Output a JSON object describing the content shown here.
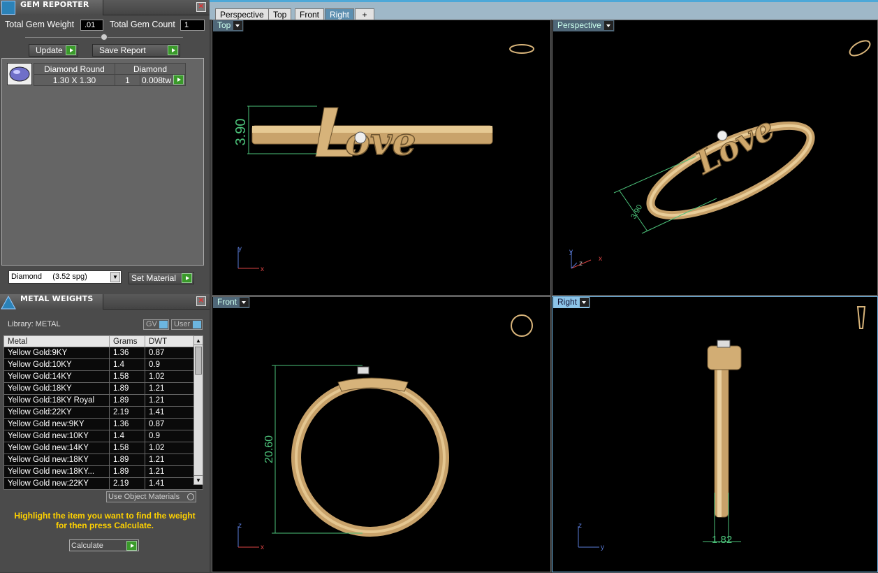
{
  "gem_reporter": {
    "title": "GEM REPORTER",
    "close_icon": "close-icon",
    "total_weight_label": "Total Gem Weight",
    "total_weight_value": ".01",
    "total_count_label": "Total Gem Count",
    "total_count_value": "1",
    "update_label": "Update",
    "save_report_label": "Save Report",
    "gem": {
      "shape": "Diamond Round",
      "size": "1.30 X 1.30",
      "material": "Diamond",
      "qty": "1",
      "weight": "0.008tw"
    },
    "material_select": "Diamond     (3.52 spg)",
    "set_material_label": "Set Material"
  },
  "metal_weights": {
    "title": "METAL WEIGHTS",
    "library_label": "Library: METAL",
    "gv_label": "GV",
    "user_label": "User",
    "columns": [
      "Metal",
      "Grams",
      "DWT"
    ],
    "rows": [
      [
        "Yellow Gold:9KY",
        "1.36",
        "0.87"
      ],
      [
        "Yellow Gold:10KY",
        "1.4",
        "0.9"
      ],
      [
        "Yellow Gold:14KY",
        "1.58",
        "1.02"
      ],
      [
        "Yellow Gold:18KY",
        "1.89",
        "1.21"
      ],
      [
        "Yellow Gold:18KY Royal",
        "1.89",
        "1.21"
      ],
      [
        "Yellow Gold:22KY",
        "2.19",
        "1.41"
      ],
      [
        "Yellow Gold new:9KY",
        "1.36",
        "0.87"
      ],
      [
        "Yellow Gold new:10KY",
        "1.4",
        "0.9"
      ],
      [
        "Yellow Gold new:14KY",
        "1.58",
        "1.02"
      ],
      [
        "Yellow Gold new:18KY",
        "1.89",
        "1.21"
      ],
      [
        "Yellow Gold new:18KY...",
        "1.89",
        "1.21"
      ],
      [
        "Yellow Gold new:22KY",
        "2.19",
        "1.41"
      ]
    ],
    "use_object_materials": "Use Object Materials",
    "hint": "Highlight the item you want to find the weight for then press Calculate.",
    "calculate_label": "Calculate"
  },
  "viewport_tabs": [
    "Perspective",
    "Top",
    "Front",
    "Right"
  ],
  "active_tab": "Right",
  "viewports": {
    "top": {
      "label": "Top",
      "dimension": "3.90",
      "axes": [
        "y",
        "x"
      ]
    },
    "perspective": {
      "label": "Perspective",
      "dimension": "3.90",
      "axes": [
        "y",
        "z",
        "x"
      ]
    },
    "front": {
      "label": "Front",
      "dimension": "20.60",
      "axes": [
        "z",
        "x"
      ]
    },
    "right": {
      "label": "Right",
      "dimension": "1.82",
      "axes": [
        "z",
        "y"
      ]
    }
  },
  "colors": {
    "accent": "#4da8d8",
    "dimension": "#4cc27a",
    "gold": "#d8b47a",
    "hint": "#ffd200"
  }
}
